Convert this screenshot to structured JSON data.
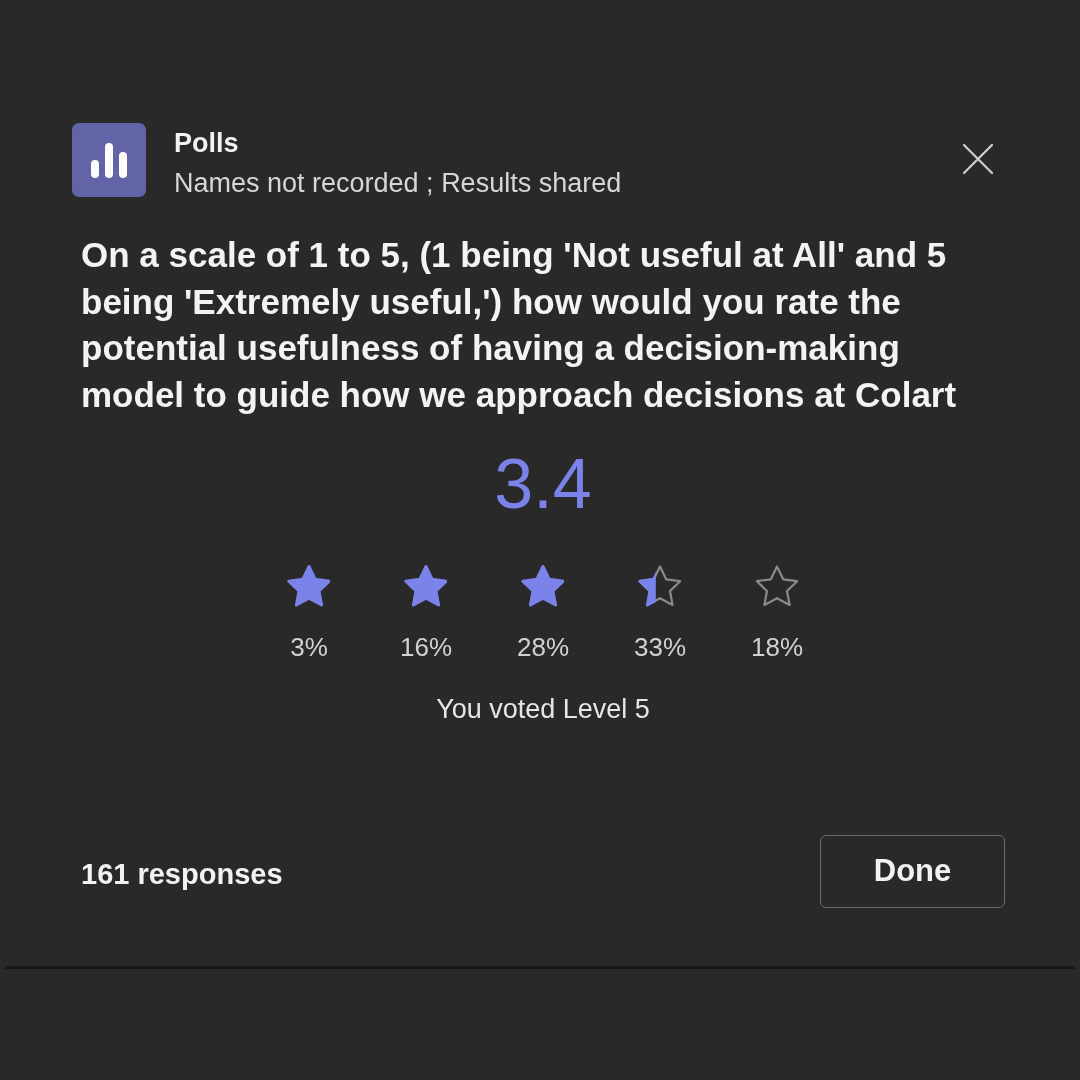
{
  "app": {
    "name": "Polls",
    "subtitle": "Names not recorded ; Results shared"
  },
  "question": "On a scale of 1 to 5, (1 being 'Not useful at All' and 5 being 'Extremely useful,') how would you rate the potential usefulness of having a decision-making model to guide how we approach decisions at Colart",
  "result": {
    "average": "3.4",
    "stars": 3.4,
    "options": [
      {
        "percent": "3%"
      },
      {
        "percent": "16%"
      },
      {
        "percent": "28%"
      },
      {
        "percent": "33%"
      },
      {
        "percent": "18%"
      }
    ]
  },
  "vote_note": "You voted Level 5",
  "footer": {
    "responses": "161 responses",
    "done_button": "Done"
  }
}
